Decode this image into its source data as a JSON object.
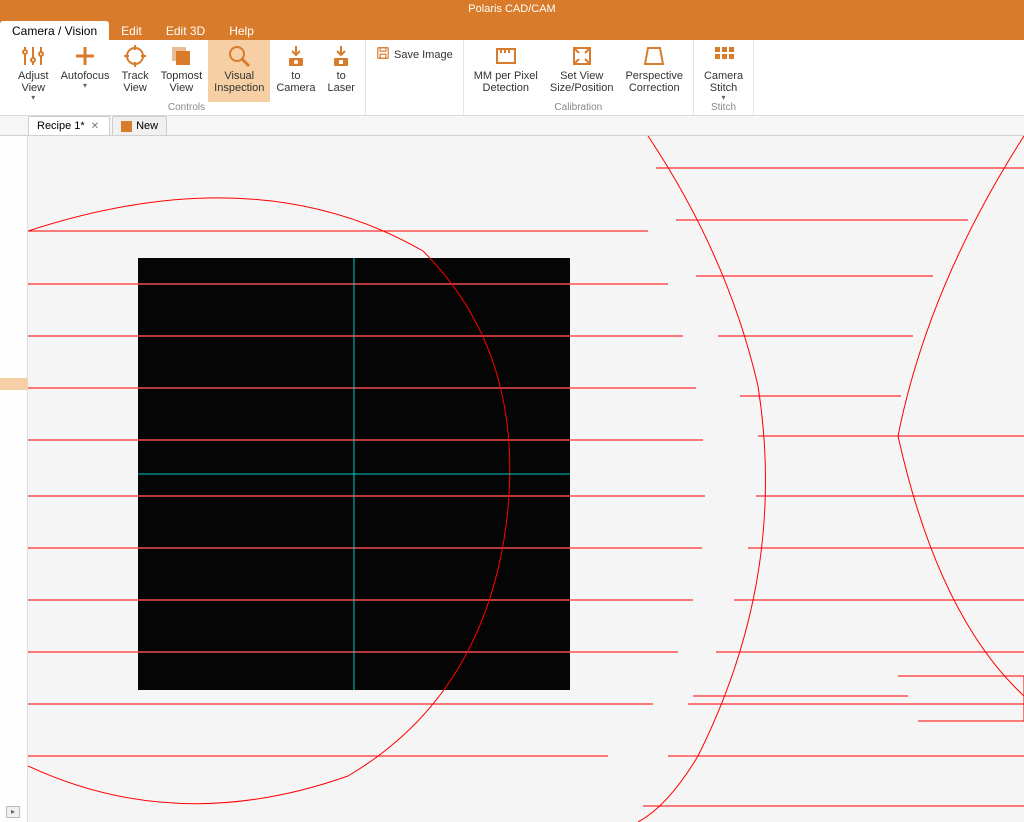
{
  "app": {
    "title": "Polaris CAD/CAM"
  },
  "menu": {
    "tabs": [
      "Camera / Vision",
      "Edit",
      "Edit 3D",
      "Help"
    ],
    "active_index": 0
  },
  "ribbon": {
    "controls_caption": "Controls",
    "calibration_caption": "Calibration",
    "stitch_caption": "Stitch",
    "buttons": {
      "adjust_view": "Adjust\nView",
      "autofocus": "Autofocus",
      "track_view": "Track\nView",
      "topmost_view": "Topmost\nView",
      "visual_inspection": "Visual\nInspection",
      "to_camera": "to\nCamera",
      "to_laser": "to\nLaser",
      "save_image": "Save Image",
      "mm_per_pixel": "MM per Pixel\nDetection",
      "set_view": "Set View\nSize/Position",
      "perspective": "Perspective\nCorrection",
      "camera_stitch": "Camera\nStitch"
    }
  },
  "doc_tabs": {
    "items": [
      {
        "label": "Recipe 1*",
        "active": true
      },
      {
        "label": "New",
        "active": false
      }
    ]
  },
  "colors": {
    "accent": "#d87b2a",
    "overlay_line": "#ff0000",
    "crosshair": "#00c8c8"
  }
}
